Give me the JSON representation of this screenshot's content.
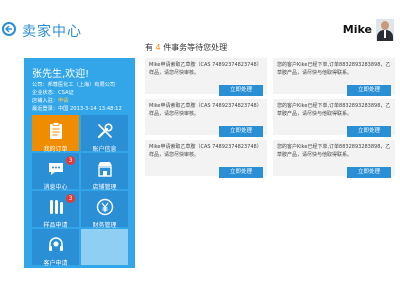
{
  "header": {
    "title": "卖家中心",
    "user_name": "Mike"
  },
  "pending": {
    "prefix": "有",
    "count": "4",
    "suffix": "件事务等待您处理"
  },
  "profile": {
    "welcome": "张先生,欢迎!",
    "company": "公司：邦尊医化工（上海）有限公司",
    "auth_label": "企业状态：",
    "auth_value": "CSA证",
    "shop_label": "店铺入驻：",
    "shop_value": "申请",
    "login_label": "最近登录：",
    "login_value": "中国 2013-3-14 13:48:12"
  },
  "tiles": [
    {
      "label": "我的订单",
      "icon": "clipboard-icon",
      "badge": ""
    },
    {
      "label": "账户信息",
      "icon": "tools-icon",
      "badge": ""
    },
    {
      "label": "消息中心",
      "icon": "chat-icon",
      "badge": "3"
    },
    {
      "label": "店铺管理",
      "icon": "shop-icon",
      "badge": ""
    },
    {
      "label": "样品申请",
      "icon": "flask-icon",
      "badge": "3"
    },
    {
      "label": "财务管理",
      "icon": "money-icon",
      "badge": ""
    },
    {
      "label": "客户申请",
      "icon": "headset-icon",
      "badge": ""
    }
  ],
  "tasks_left": [
    {
      "text": "Mike申请索取乙草胺（CAS 74892374823748）样品，请您尽快审核。",
      "button": "立即处理"
    },
    {
      "text": "Mike申请索取乙草胺（CAS 74892374823748）样品，请您尽快审核。",
      "button": "立即处理"
    },
    {
      "text": "Mike申请索取乙草胺（CAS 74892374823748）样品，请您尽快审核。",
      "button": "立即处理"
    }
  ],
  "tasks_right": [
    {
      "text": "您的客户Kike已经下单,订单8832893283898，乙草胺产品，请尽快与他取得联系。",
      "button": "立即处理"
    },
    {
      "text": "您的客户Kike已经下单,订单8832893283898，乙草胺产品，请尽快与他取得联系。",
      "button": "立即处理"
    },
    {
      "text": "您的客户Kike已经下单,订单8832893283898，乙草胺产品，请尽快与他取得联系。",
      "button": "立即处理"
    }
  ]
}
